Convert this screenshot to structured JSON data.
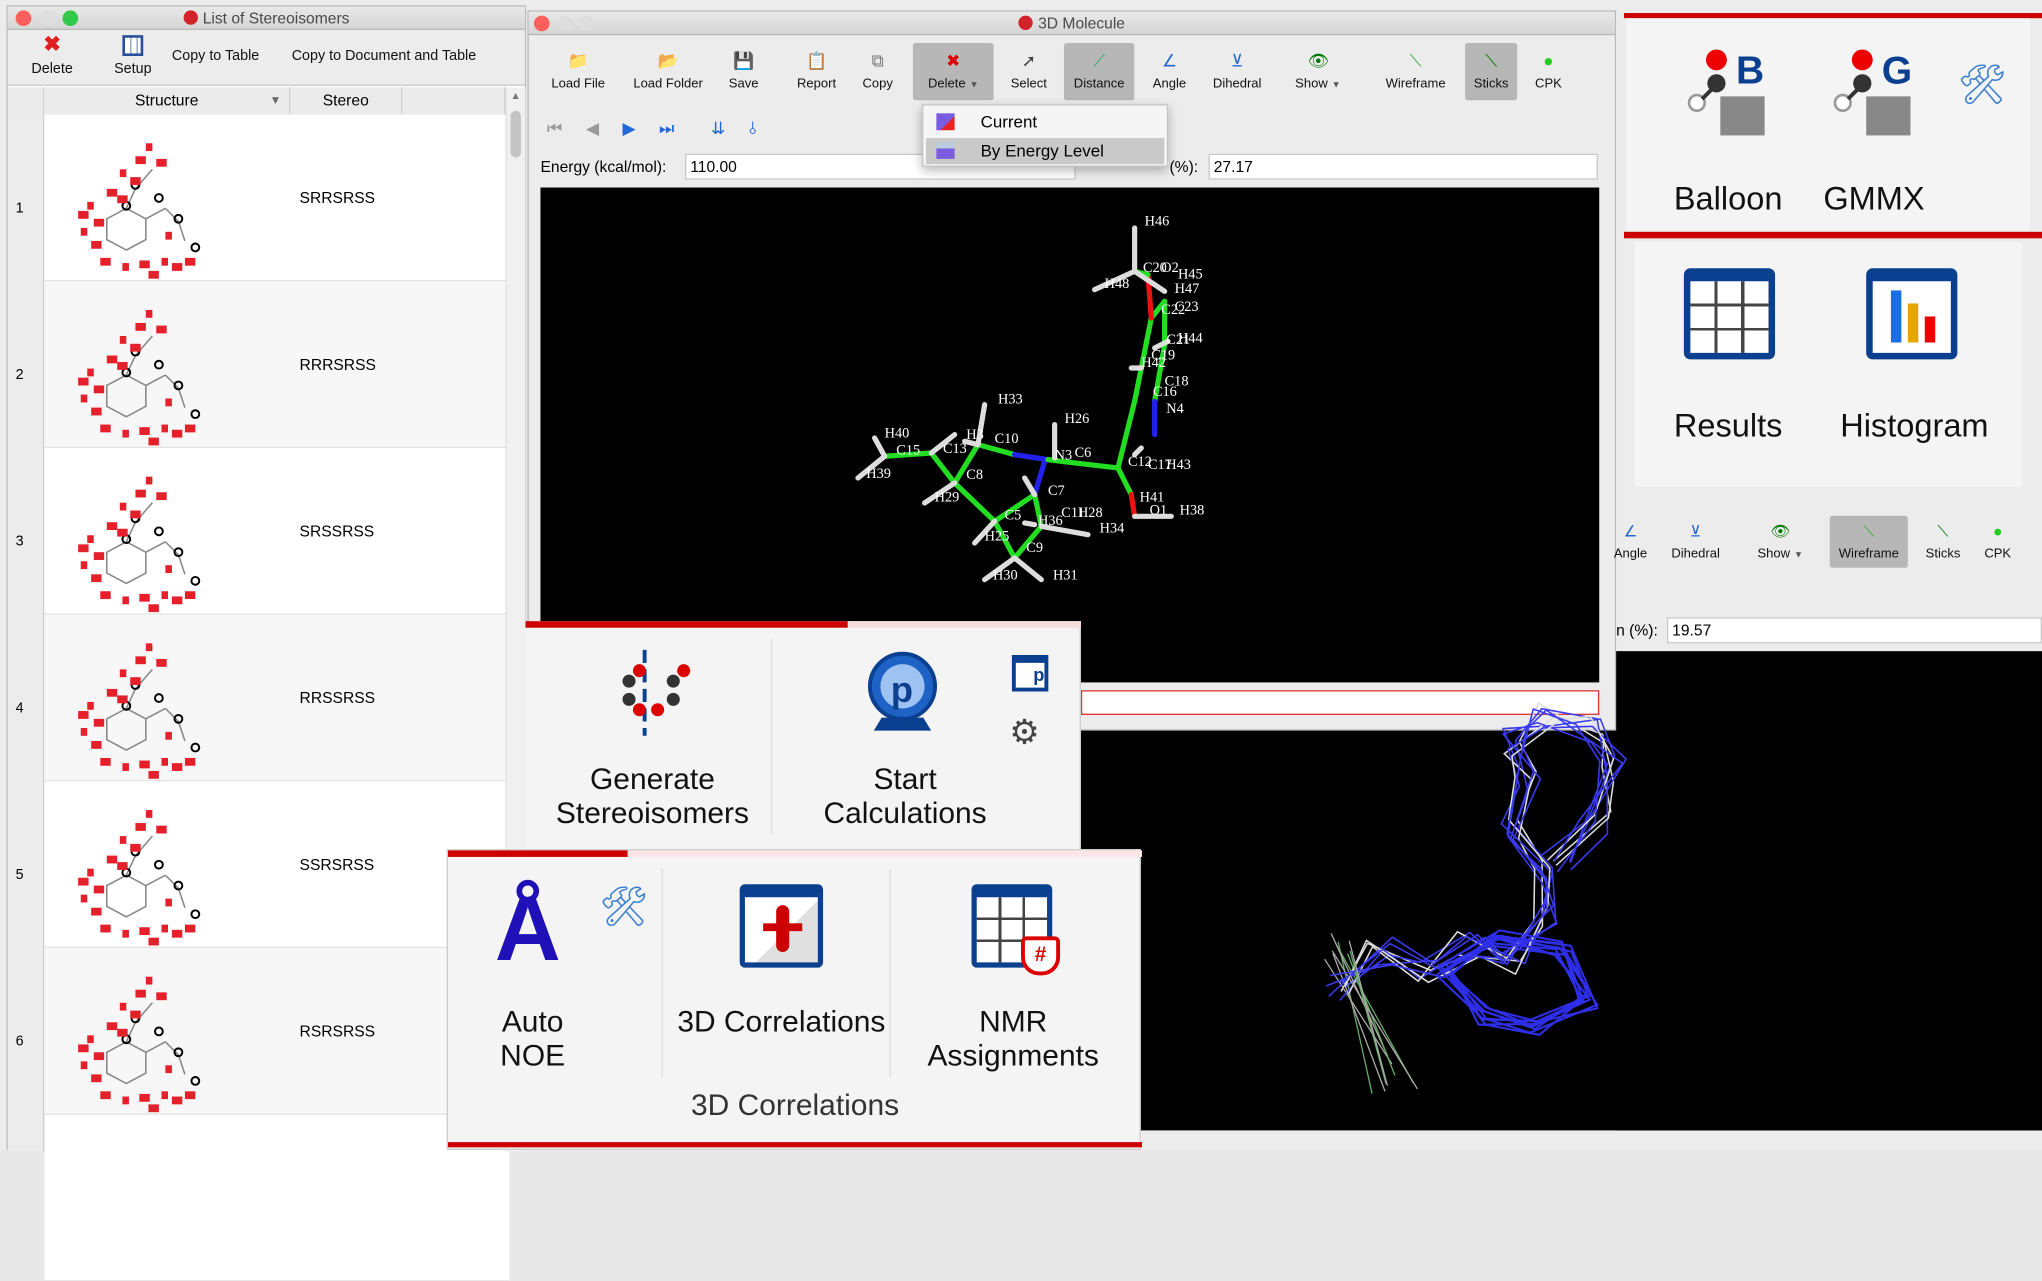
{
  "stereo_window": {
    "title": "List of Stereoisomers",
    "toolbar": {
      "delete": "Delete",
      "setup": "Setup",
      "copy_table": "Copy to Table",
      "copy_doc": "Copy to Document and Table"
    },
    "columns": [
      "Structure",
      "Stereo"
    ],
    "rows": [
      {
        "num": "1",
        "stereo": "SRRSRSS"
      },
      {
        "num": "2",
        "stereo": "RRRSRSS"
      },
      {
        "num": "3",
        "stereo": "SRSSRSS"
      },
      {
        "num": "4",
        "stereo": "RRSSRSS"
      },
      {
        "num": "5",
        "stereo": "SSRSRSS"
      },
      {
        "num": "6",
        "stereo": "RSRSRSS"
      }
    ]
  },
  "mol_window": {
    "title": "3D Molecule",
    "toolbar": [
      "Load File",
      "Load Folder",
      "Save",
      "Report",
      "Copy",
      "Delete",
      "Select",
      "Distance",
      "Angle",
      "Dihedral",
      "Show",
      "Wireframe",
      "Sticks",
      "CPK"
    ],
    "selected": [
      "Delete",
      "Distance",
      "Sticks"
    ],
    "energy_label": "Energy (kcal/mol):",
    "energy_value": "110.00",
    "population_label": "(%):",
    "population_value": "27.17",
    "delete_menu": {
      "items": [
        "Current",
        "By Energy Level"
      ],
      "highlighted": "By Energy Level"
    },
    "atom_labels": [
      "H46",
      "C20",
      "O2",
      "H45",
      "H48",
      "H47",
      "C22",
      "C23",
      "C21",
      "H44",
      "C19",
      "H42",
      "C18",
      "C16",
      "N4",
      "H33",
      "H26",
      "H40",
      "C15",
      "C13",
      "H3",
      "C10",
      "N3",
      "C6",
      "C12",
      "C17",
      "H43",
      "C8",
      "C7",
      "H29",
      "H41",
      "O1",
      "H38",
      "C5",
      "H36",
      "C11",
      "H28",
      "H34",
      "H25",
      "C9",
      "H30",
      "H31",
      "H39"
    ]
  },
  "right_window": {
    "ribbon1": [
      "Balloon",
      "GMMX"
    ],
    "ribbon2": [
      "Results",
      "Histogram"
    ],
    "toolbar": [
      "Angle",
      "Dihedral",
      "Show",
      "Wireframe",
      "Sticks",
      "CPK"
    ],
    "selected": "Wireframe",
    "population_label": "n (%):",
    "population_value": "19.57"
  },
  "ribbon_calc": {
    "generate": "Generate Stereoisomers",
    "start": "Start Calculations"
  },
  "ribbon_corr": {
    "auto_noe": "Auto NOE",
    "corr3d": "3D Correlations",
    "nmr": "NMR Assignments",
    "group": "3D Correlations"
  },
  "colors": {
    "accent_red": "#cc0000",
    "icon_blue": "#003f8a",
    "atom_carbon": "#22dd22",
    "atom_nitrogen": "#2222ee",
    "atom_oxygen": "#ee1111",
    "viewer_bg": "#000000"
  }
}
